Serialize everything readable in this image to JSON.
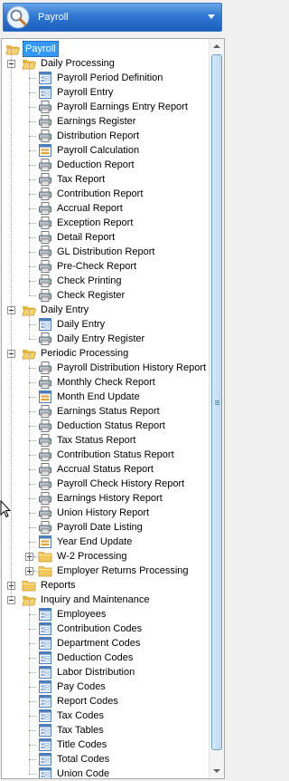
{
  "header": {
    "module_label": "Payroll",
    "icon": "search-magnifier-icon"
  },
  "tree": {
    "root": {
      "label": "Payroll",
      "icon": "folder-open-icon",
      "selected": true
    },
    "groups": [
      {
        "label": "Daily Processing",
        "expanded": true,
        "items": [
          {
            "label": "Payroll Period Definition",
            "icon": "form-icon"
          },
          {
            "label": "Payroll Entry",
            "icon": "form-icon"
          },
          {
            "label": "Payroll Earnings Entry Report",
            "icon": "printer-icon"
          },
          {
            "label": "Earnings Register",
            "icon": "printer-icon"
          },
          {
            "label": "Distribution Report",
            "icon": "printer-icon"
          },
          {
            "label": "Payroll Calculation",
            "icon": "update-icon"
          },
          {
            "label": "Deduction Report",
            "icon": "printer-icon"
          },
          {
            "label": "Tax Report",
            "icon": "printer-icon"
          },
          {
            "label": "Contribution Report",
            "icon": "printer-icon"
          },
          {
            "label": "Accrual Report",
            "icon": "printer-icon"
          },
          {
            "label": "Exception Report",
            "icon": "printer-icon"
          },
          {
            "label": "Detail Report",
            "icon": "printer-icon"
          },
          {
            "label": "GL Distribution Report",
            "icon": "printer-icon"
          },
          {
            "label": "Pre-Check Report",
            "icon": "printer-icon"
          },
          {
            "label": "Check Printing",
            "icon": "printer-icon"
          },
          {
            "label": "Check Register",
            "icon": "printer-icon"
          }
        ]
      },
      {
        "label": "Daily Entry",
        "expanded": true,
        "items": [
          {
            "label": "Daily Entry",
            "icon": "form-icon"
          },
          {
            "label": "Daily Entry Register",
            "icon": "printer-icon"
          }
        ]
      },
      {
        "label": "Periodic Processing",
        "expanded": true,
        "items": [
          {
            "label": "Payroll Distribution History Report",
            "icon": "printer-icon"
          },
          {
            "label": "Monthly Check Report",
            "icon": "printer-icon"
          },
          {
            "label": "Month End Update",
            "icon": "update-icon"
          },
          {
            "label": "Earnings Status Report",
            "icon": "printer-icon"
          },
          {
            "label": "Deduction Status Report",
            "icon": "printer-icon"
          },
          {
            "label": "Tax Status Report",
            "icon": "printer-icon"
          },
          {
            "label": "Contribution Status Report",
            "icon": "printer-icon"
          },
          {
            "label": "Accrual Status Report",
            "icon": "printer-icon"
          },
          {
            "label": "Payroll Check History Report",
            "icon": "printer-icon"
          },
          {
            "label": "Earnings History Report",
            "icon": "printer-icon"
          },
          {
            "label": "Union History Report",
            "icon": "printer-icon"
          },
          {
            "label": "Payroll Date Listing",
            "icon": "printer-icon"
          },
          {
            "label": "Year End Update",
            "icon": "update-icon"
          }
        ],
        "subgroups": [
          {
            "label": "W-2 Processing",
            "expanded": false
          },
          {
            "label": "Employer Returns Processing",
            "expanded": false
          }
        ]
      },
      {
        "label": "Reports",
        "expanded": false,
        "items": []
      },
      {
        "label": "Inquiry and Maintenance",
        "expanded": true,
        "items": [
          {
            "label": "Employees",
            "icon": "form-icon"
          },
          {
            "label": "Contribution Codes",
            "icon": "form-icon"
          },
          {
            "label": "Department Codes",
            "icon": "form-icon"
          },
          {
            "label": "Deduction Codes",
            "icon": "form-icon"
          },
          {
            "label": "Labor Distribution",
            "icon": "form-icon"
          },
          {
            "label": "Pay Codes",
            "icon": "form-icon"
          },
          {
            "label": "Report Codes",
            "icon": "form-icon"
          },
          {
            "label": "Tax Codes",
            "icon": "form-icon"
          },
          {
            "label": "Tax Tables",
            "icon": "form-icon"
          },
          {
            "label": "Title Codes",
            "icon": "form-icon"
          },
          {
            "label": "Total Codes",
            "icon": "form-icon"
          },
          {
            "label": "Union Code",
            "icon": "form-icon"
          }
        ]
      }
    ]
  },
  "colors": {
    "selection": "#3399ff",
    "header_gradient_top": "#6aa6e8",
    "header_gradient_bottom": "#1d5fbd",
    "folder": "#f2c14e"
  }
}
